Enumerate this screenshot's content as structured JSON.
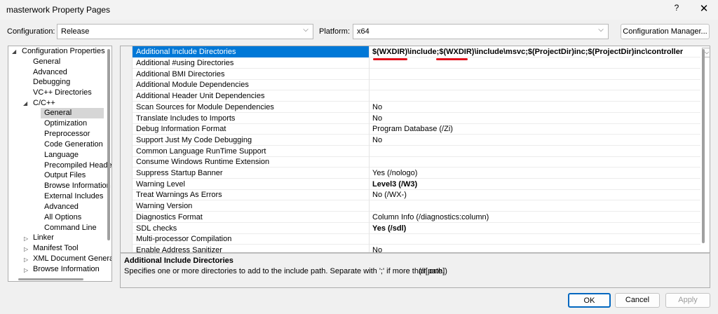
{
  "window": {
    "title": "masterwork Property Pages",
    "help_glyph": "?",
    "close_glyph": "✕"
  },
  "config": {
    "configuration_label": "Configuration:",
    "configuration_value": "Release",
    "platform_label": "Platform:",
    "platform_value": "x64",
    "manager_button": "Configuration Manager..."
  },
  "tree": {
    "items": [
      {
        "label": "Configuration Properties",
        "expanded": true
      },
      {
        "label": "General"
      },
      {
        "label": "Advanced"
      },
      {
        "label": "Debugging"
      },
      {
        "label": "VC++ Directories"
      },
      {
        "label": "C/C++",
        "expanded": true
      },
      {
        "label": "General",
        "selected": true
      },
      {
        "label": "Optimization"
      },
      {
        "label": "Preprocessor"
      },
      {
        "label": "Code Generation"
      },
      {
        "label": "Language"
      },
      {
        "label": "Precompiled Heade"
      },
      {
        "label": "Output Files"
      },
      {
        "label": "Browse Information"
      },
      {
        "label": "External Includes"
      },
      {
        "label": "Advanced"
      },
      {
        "label": "All Options"
      },
      {
        "label": "Command Line"
      },
      {
        "label": "Linker",
        "expanded": false
      },
      {
        "label": "Manifest Tool",
        "expanded": false
      },
      {
        "label": "XML Document Genera",
        "expanded": false
      },
      {
        "label": "Browse Information",
        "expanded": false
      }
    ]
  },
  "grid": {
    "rows": [
      {
        "name": "Additional Include Directories",
        "value": "$(WXDIR)\\include;$(WXDIR)\\include\\msvc;$(ProjectDir)inc;$(ProjectDir)inc\\controller",
        "bold": true,
        "selected": true
      },
      {
        "name": "Additional #using Directories",
        "value": ""
      },
      {
        "name": "Additional BMI Directories",
        "value": ""
      },
      {
        "name": "Additional Module Dependencies",
        "value": ""
      },
      {
        "name": "Additional Header Unit Dependencies",
        "value": ""
      },
      {
        "name": "Scan Sources for Module Dependencies",
        "value": "No"
      },
      {
        "name": "Translate Includes to Imports",
        "value": "No"
      },
      {
        "name": "Debug Information Format",
        "value": "Program Database (/Zi)"
      },
      {
        "name": "Support Just My Code Debugging",
        "value": "No"
      },
      {
        "name": "Common Language RunTime Support",
        "value": ""
      },
      {
        "name": "Consume Windows Runtime Extension",
        "value": ""
      },
      {
        "name": "Suppress Startup Banner",
        "value": "Yes (/nologo)"
      },
      {
        "name": "Warning Level",
        "value": "Level3 (/W3)",
        "bold": true
      },
      {
        "name": "Treat Warnings As Errors",
        "value": "No (/WX-)"
      },
      {
        "name": "Warning Version",
        "value": ""
      },
      {
        "name": "Diagnostics Format",
        "value": "Column Info (/diagnostics:column)"
      },
      {
        "name": "SDL checks",
        "value": "Yes (/sdl)",
        "bold": true
      },
      {
        "name": "Multi-processor Compilation",
        "value": ""
      },
      {
        "name": "Enable Address Sanitizer",
        "value": "No"
      }
    ]
  },
  "description": {
    "title": "Additional Include Directories",
    "text": "Specifies one or more directories to add to the include path. Separate with ';' if more than one.",
    "switch": "(/I[path])"
  },
  "buttons": {
    "ok": "OK",
    "cancel": "Cancel",
    "apply": "Apply"
  },
  "colors": {
    "selection": "#0078d7",
    "annotation": "#e0101a"
  }
}
